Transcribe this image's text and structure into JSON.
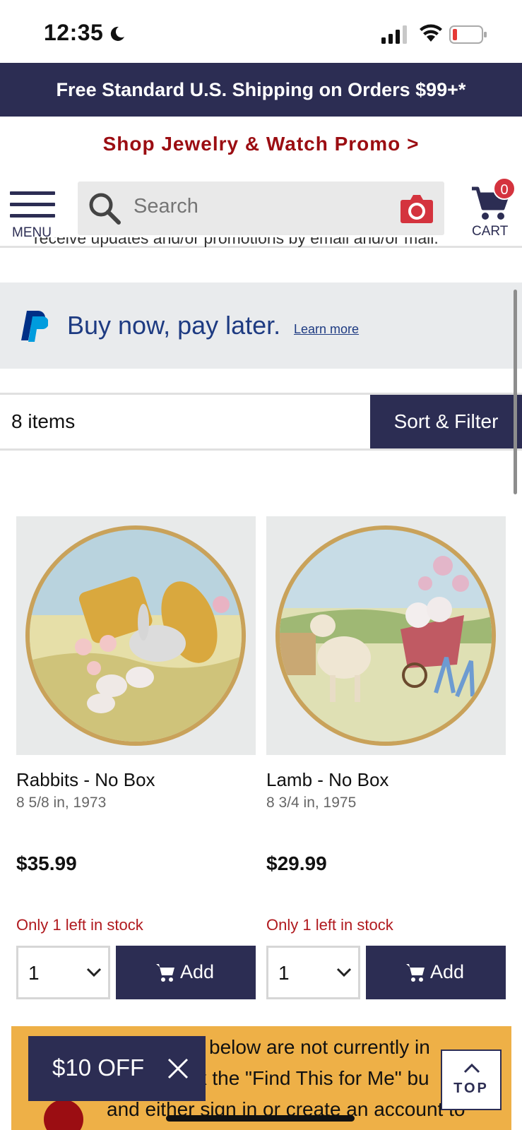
{
  "status_bar": {
    "time": "12:35"
  },
  "shipping_banner": "Free Standard U.S. Shipping on Orders $99+*",
  "promo_link": "Shop Jewelry & Watch Promo >",
  "header": {
    "menu_label": "MENU",
    "search_placeholder": "Search",
    "cart_label": "CART",
    "cart_count": "0"
  },
  "cut_off_text": "receive updates and/or promotions by email and/or mail.",
  "paypal": {
    "text": "Buy now, pay later.",
    "link": "Learn more"
  },
  "results": {
    "count": "8 items",
    "sort_filter": "Sort & Filter"
  },
  "products": [
    {
      "name": "Rabbits - No Box",
      "details": "8 5/8 in, 1973",
      "price": "$35.99",
      "stock": "Only 1 left in stock",
      "quantity": "1",
      "add_label": "Add"
    },
    {
      "name": "Lamb - No Box",
      "details": "8 3/4 in, 1975",
      "price": "$29.99",
      "stock": "Only 1 left in stock",
      "quantity": "1",
      "add_label": "Add"
    }
  ],
  "notice": {
    "line1": "below are not currently in",
    "line2": "stock. Click the \"Find This for Me\" bu",
    "line3": "and either sign in or create an account to"
  },
  "offer": {
    "text": "$10 OFF"
  },
  "back_to_top": "TOP",
  "colors": {
    "navy": "#2c2d53",
    "promo_red": "#9b0d12",
    "stock_red": "#b0191e",
    "notice_yellow": "#eeb047",
    "paypal_blue": "#1e3b82"
  }
}
